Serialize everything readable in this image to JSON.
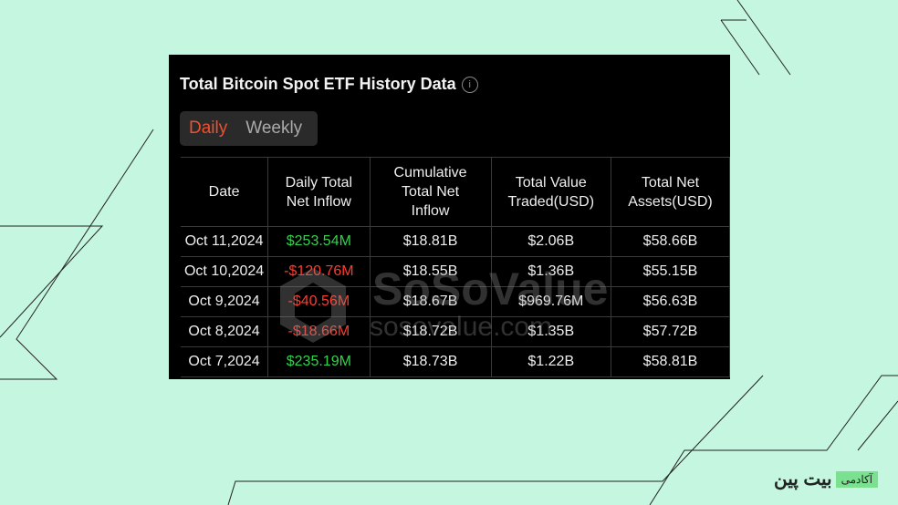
{
  "panel": {
    "title": "Total Bitcoin Spot ETF History Data",
    "info_icon": "info-icon",
    "tabs": [
      {
        "label": "Daily",
        "active": true
      },
      {
        "label": "Weekly",
        "active": false
      }
    ],
    "columns": [
      "Date",
      "Daily Total Net Inflow",
      "Cumulative Total Net Inflow",
      "Total Value Traded(USD)",
      "Total Net Assets(USD)"
    ],
    "rows": [
      {
        "date": "Oct 11,2024",
        "inflow": "$253.54M",
        "cumulative": "$18.81B",
        "traded": "$2.06B",
        "assets": "$58.66B",
        "positive": true
      },
      {
        "date": "Oct 10,2024",
        "inflow": "-$120.76M",
        "cumulative": "$18.55B",
        "traded": "$1.36B",
        "assets": "$55.15B",
        "positive": false
      },
      {
        "date": "Oct 9,2024",
        "inflow": "-$40.56M",
        "cumulative": "$18.67B",
        "traded": "$969.76M",
        "assets": "$56.63B",
        "positive": false
      },
      {
        "date": "Oct 8,2024",
        "inflow": "-$18.66M",
        "cumulative": "$18.72B",
        "traded": "$1.35B",
        "assets": "$57.72B",
        "positive": false
      },
      {
        "date": "Oct 7,2024",
        "inflow": "$235.19M",
        "cumulative": "$18.73B",
        "traded": "$1.22B",
        "assets": "$58.81B",
        "positive": true
      }
    ],
    "watermark": {
      "brand": "SoSoValue",
      "url": "sosovalue.com"
    }
  },
  "logo": {
    "name": "بیت پین",
    "badge": "آکادمی"
  },
  "colors": {
    "background": "#c4f6e0",
    "positive": "#2fd44a",
    "negative": "#ff3b30",
    "active_tab": "#f0502e"
  }
}
